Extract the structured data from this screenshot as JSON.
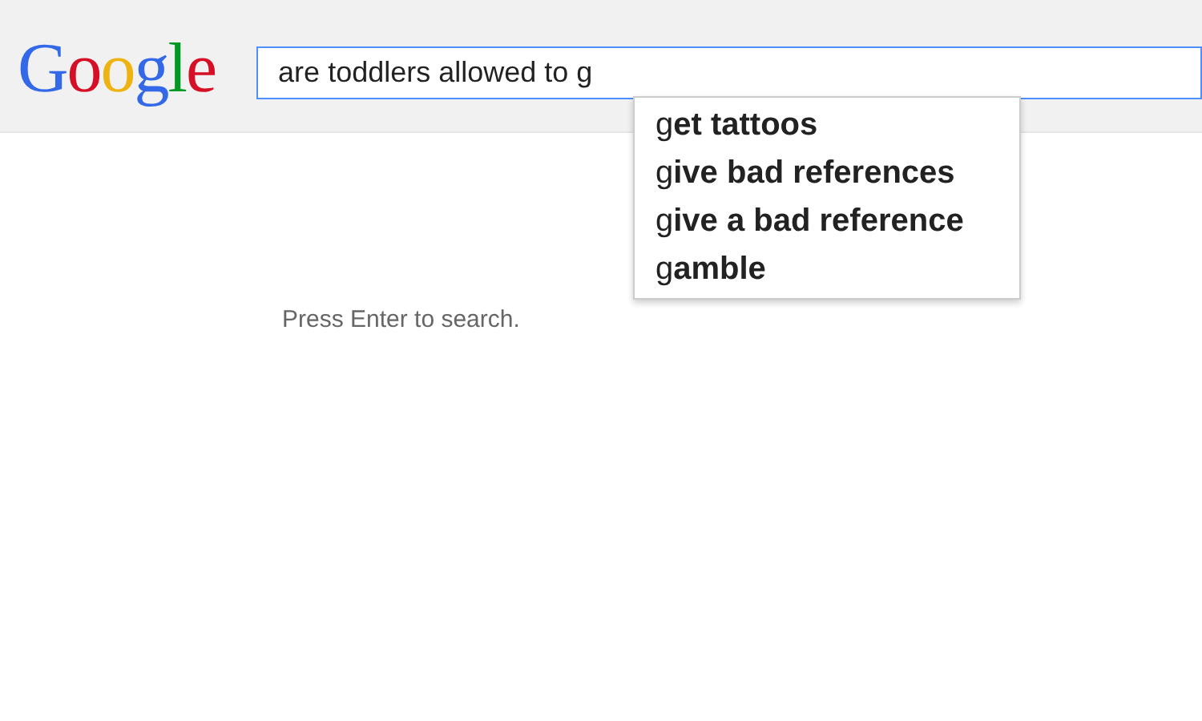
{
  "logo": {
    "text": "Google"
  },
  "search": {
    "value": "are toddlers allowed to g"
  },
  "suggestions": [
    {
      "text": "g**et tattoos**"
    },
    {
      "text": "g**ive bad references**"
    },
    {
      "text": "g**ive a bad reference**"
    },
    {
      "text": "g**amble**"
    }
  ],
  "hint": "Press Enter to search."
}
